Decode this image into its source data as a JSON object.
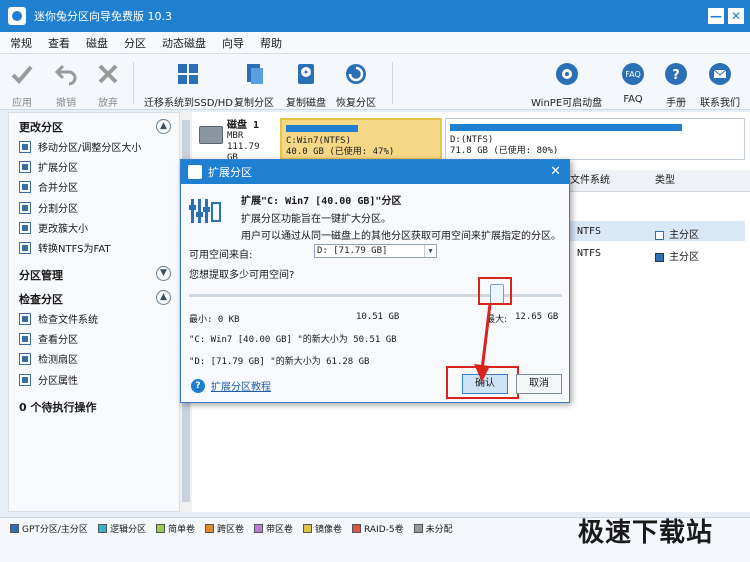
{
  "window": {
    "title": "迷你兔分区向导免费版 10.3",
    "min": "—",
    "close": "✕"
  },
  "menu": [
    "常规",
    "查看",
    "磁盘",
    "分区",
    "动态磁盘",
    "向导",
    "帮助"
  ],
  "toolbar": {
    "apply": "应用",
    "undo": "撤销",
    "discard": "放弃",
    "migrate": "迁移系统到SSD/HD",
    "copy_partition": "复制分区",
    "copy_disk": "复制磁盘",
    "recover": "恢复分区",
    "winpe": "WinPE可启动盘",
    "faq": "FAQ",
    "manual": "手册",
    "contact": "联系我们"
  },
  "sidebar": {
    "sec1": "更改分区",
    "items1": [
      "移动分区/调整分区大小",
      "扩展分区",
      "合并分区",
      "分割分区",
      "更改簇大小",
      "转换NTFS为FAT"
    ],
    "sec2": "分区管理",
    "sec3": "检查分区",
    "items3": [
      "检查文件系统",
      "查看分区",
      "检测扇区",
      "分区属性"
    ],
    "pending": "0 个待执行操作"
  },
  "disk": {
    "name": "磁盘 1",
    "type": "MBR",
    "size": "111.79 GB",
    "c_label": "C:Win7(NTFS)",
    "c_info": "40.0 GB (已使用: 47%)",
    "c_used": 0.47,
    "d_label": "D:(NTFS)",
    "d_info": "71.8 GB (已使用: 80%)",
    "d_used": 0.8
  },
  "table": {
    "col_fs": "文件系统",
    "col_type": "类型",
    "rows": [
      {
        "fs": "NTFS",
        "type": "主分区"
      },
      {
        "fs": "NTFS",
        "type": "主分区"
      }
    ]
  },
  "dialog": {
    "title": "扩展分区",
    "close": "✕",
    "heading": "扩展\"C: Win7 [40.00 GB]\"分区",
    "desc1": "扩展分区功能旨在一键扩大分区。",
    "desc2": "用户可以通过从同一磁盘上的其他分区获取可用空间来扩展指定的分区。",
    "from_label": "可用空间来自:",
    "from_value": "D:   [71.79 GB]",
    "question": "您想提取多少可用空间?",
    "min": "最小: 0 KB",
    "current": "10.51 GB",
    "max_label": "最大:",
    "max": "12.65 GB",
    "new_c": "\"C: Win7 [40.00 GB] \"的新大小为 50.51 GB",
    "new_d": "\"D: [71.79 GB] \"的新大小为 61.28 GB",
    "help": "扩展分区教程",
    "ok": "确认",
    "cancel": "取消"
  },
  "legend": [
    "GPT分区/主分区",
    "逻辑分区",
    "简单卷",
    "跨区卷",
    "带区卷",
    "镜像卷",
    "RAID-5卷",
    "未分配"
  ],
  "legend_colors": [
    "#2b6fb6",
    "#35b5c9",
    "#9acd52",
    "#e08a36",
    "#b780d1",
    "#d9c34a",
    "#e04e4e",
    "#9a9a9a"
  ],
  "watermark": "极速下载站"
}
